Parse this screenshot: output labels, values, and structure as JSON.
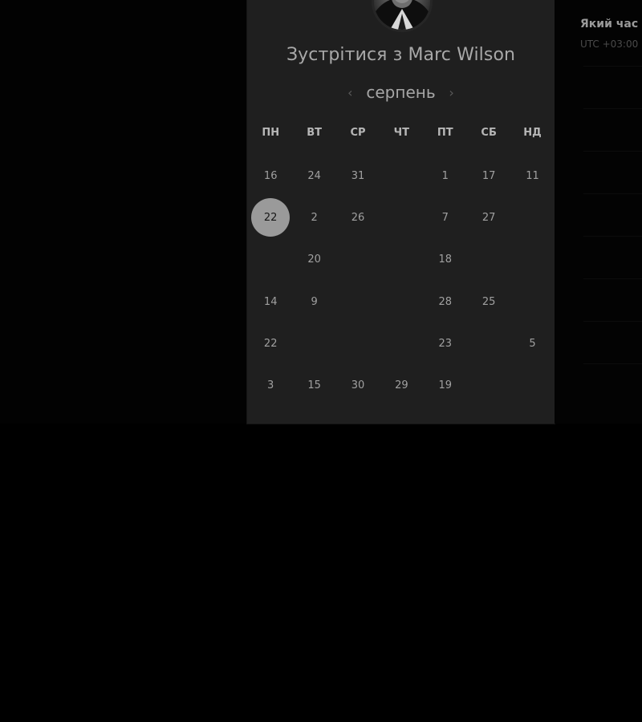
{
  "booking": {
    "title": "Зустрітися з Marc Wilson",
    "month": "серпень",
    "prev_icon": "chevron-left-icon",
    "next_icon": "chevron-right-icon"
  },
  "weekdays": [
    "ПН",
    "ВТ",
    "СР",
    "ЧТ",
    "ПТ",
    "СБ",
    "НД"
  ],
  "days": [
    {
      "label": "16",
      "state": "available"
    },
    {
      "label": "24",
      "state": "available"
    },
    {
      "label": "31",
      "state": "available"
    },
    {
      "label": "",
      "state": "disabled"
    },
    {
      "label": "1",
      "state": "available"
    },
    {
      "label": "17",
      "state": "available"
    },
    {
      "label": "11",
      "state": "available"
    },
    {
      "label": "22",
      "state": "selected"
    },
    {
      "label": "2",
      "state": "available"
    },
    {
      "label": "26",
      "state": "available"
    },
    {
      "label": "",
      "state": "disabled"
    },
    {
      "label": "7",
      "state": "available"
    },
    {
      "label": "27",
      "state": "available"
    },
    {
      "label": "",
      "state": "disabled"
    },
    {
      "label": "",
      "state": "disabled"
    },
    {
      "label": "20",
      "state": "available"
    },
    {
      "label": "",
      "state": "disabled"
    },
    {
      "label": "",
      "state": "disabled"
    },
    {
      "label": "18",
      "state": "available"
    },
    {
      "label": "",
      "state": "disabled"
    },
    {
      "label": "",
      "state": "disabled"
    },
    {
      "label": "14",
      "state": "available"
    },
    {
      "label": "9",
      "state": "available"
    },
    {
      "label": "",
      "state": "disabled"
    },
    {
      "label": "",
      "state": "disabled"
    },
    {
      "label": "28",
      "state": "available"
    },
    {
      "label": "25",
      "state": "available"
    },
    {
      "label": "",
      "state": "disabled"
    },
    {
      "label": "22",
      "state": "available"
    },
    {
      "label": "",
      "state": "disabled"
    },
    {
      "label": "",
      "state": "disabled"
    },
    {
      "label": "",
      "state": "disabled"
    },
    {
      "label": "23",
      "state": "available"
    },
    {
      "label": "",
      "state": "disabled"
    },
    {
      "label": "5",
      "state": "available"
    },
    {
      "label": "3",
      "state": "available"
    },
    {
      "label": "15",
      "state": "available"
    },
    {
      "label": "30",
      "state": "available"
    },
    {
      "label": "29",
      "state": "available"
    },
    {
      "label": "19",
      "state": "available"
    },
    {
      "label": "",
      "state": "disabled"
    },
    {
      "label": "",
      "state": "disabled"
    }
  ],
  "side": {
    "question": "Який час е",
    "timezone": "UTC +03:00"
  },
  "colors": {
    "card": "#1f1f1f",
    "selected": "#9a9a9a",
    "text": "#a8a8a8"
  }
}
